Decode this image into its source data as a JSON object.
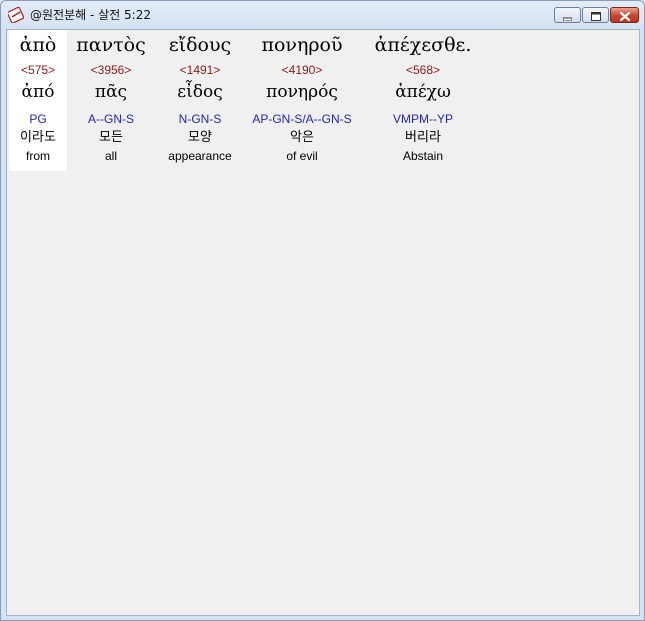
{
  "window": {
    "title": "@원전분해 - 살전 5:22",
    "buttons": {
      "minimize": "minimize",
      "maximize": "maximize",
      "close": "close"
    }
  },
  "words": [
    {
      "greek": "ἀπὸ",
      "strong": "<575>",
      "lemma": "ἀπό",
      "parse": "PG",
      "korean": "이라도",
      "english": "from",
      "selected": true
    },
    {
      "greek": "παντὸς",
      "strong": "<3956>",
      "lemma": "πᾶς",
      "parse": "A--GN-S",
      "korean": "모든",
      "english": "all",
      "selected": false
    },
    {
      "greek": "εἴδους",
      "strong": "<1491>",
      "lemma": "εἶδος",
      "parse": "N-GN-S",
      "korean": "모양",
      "english": "appearance",
      "selected": false
    },
    {
      "greek": "πονηροῦ",
      "strong": "<4190>",
      "lemma": "πονηρός",
      "parse": "AP-GN-S/A--GN-S",
      "korean": "악은",
      "english": "of evil",
      "selected": false
    },
    {
      "greek": "ἀπέχεσθε.",
      "strong": "<568>",
      "lemma": "ἀπέχω",
      "parse": "VMPM--YP",
      "korean": "버리라",
      "english": "Abstain",
      "selected": false
    }
  ],
  "colors": {
    "strong_number": "#8b1a1a",
    "parse_code": "#2626a8",
    "selected_background": "#ffffff",
    "client_background": "#f0f0f0"
  }
}
